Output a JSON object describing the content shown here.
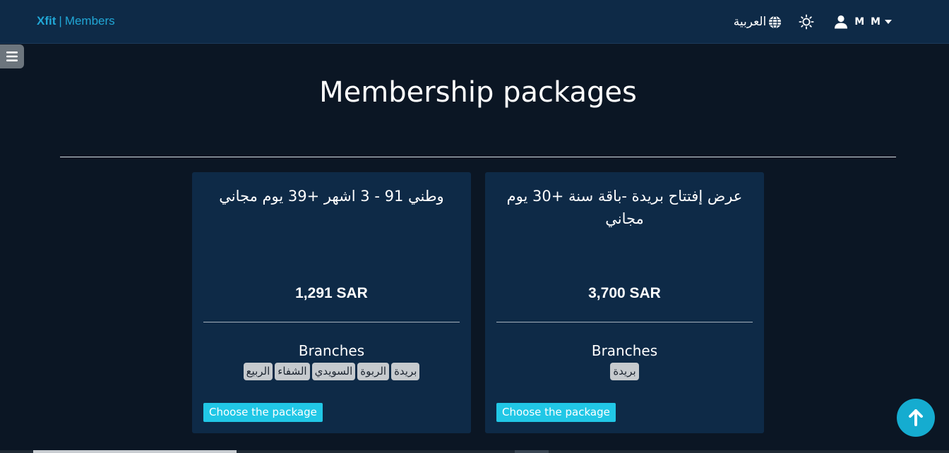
{
  "navbar": {
    "brand_name": "Xfit",
    "brand_separator": "|",
    "brand_section": "Members",
    "language_label": "العربية",
    "language_icon": "globe-icon",
    "theme_icon": "sun-icon",
    "user_name": "M M",
    "user_icon": "user-icon"
  },
  "sidebar": {
    "toggle_icon": "hamburger-icon"
  },
  "page": {
    "title": "Membership packages"
  },
  "packages": [
    {
      "title": "وطني 91 - 3 اشهر +39 يوم مجاني",
      "price": "1,291 SAR",
      "branches_label": "Branches",
      "branches": [
        "بريدة",
        "الربوة",
        "السويدي",
        "الشفاء",
        "الربيع"
      ],
      "button_label": "Choose the package"
    },
    {
      "title": "عرض إفتتاح بريدة -باقة سنة +30 يوم مجاني",
      "price": "3,700 SAR",
      "branches_label": "Branches",
      "branches": [
        "بريدة"
      ],
      "button_label": "Choose the package"
    }
  ],
  "colors": {
    "background": "#0b1624",
    "navbar": "#0e2a47",
    "card": "#0e2a47",
    "accent": "#21a7d6",
    "button": "#21c7e6",
    "badge": "#c6cace"
  },
  "scroll_top": {
    "icon": "arrow-up-icon"
  }
}
